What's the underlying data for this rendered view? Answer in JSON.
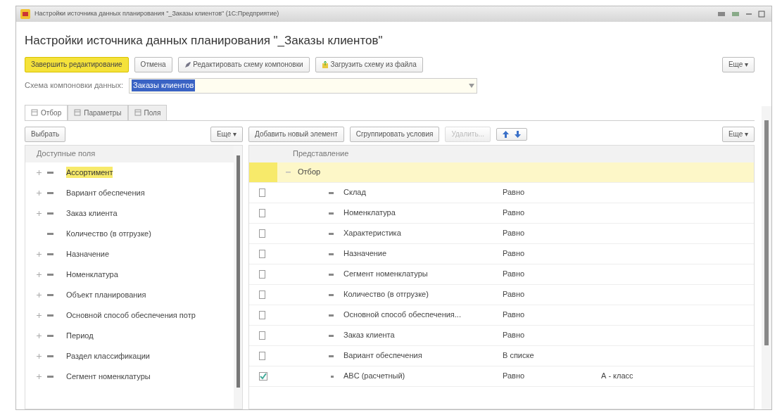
{
  "window": {
    "title": "Настройки источника данных планирования \"_Заказы клиентов\" (1С:Предприятие)"
  },
  "heading": "Настройки источника данных планирования \"_Заказы клиентов\"",
  "toolbar": [
    {
      "label": "Завершить редактирование",
      "kind": "primary"
    },
    {
      "label": "Отмена",
      "kind": "plain"
    },
    {
      "label": "Редактировать схему компоновки",
      "kind": "edit"
    },
    {
      "label": "Загрузить схему из файла",
      "kind": "load"
    }
  ],
  "more_label": "Еще ▾",
  "schema_field": {
    "label": "Схема компоновки данных:",
    "value": "Заказы клиентов"
  },
  "tabs": [
    {
      "label": "Отбор",
      "selected": true
    },
    {
      "label": "Параметры",
      "selected": false
    },
    {
      "label": "Поля",
      "selected": false
    }
  ],
  "left_panel": {
    "select_button": "Выбрать",
    "more_label": "Еще ▾",
    "header": "Доступные поля",
    "items": [
      {
        "label": "Ассортимент",
        "expandable": true,
        "selected": true
      },
      {
        "label": "Вариант обеспечения",
        "expandable": true,
        "selected": false
      },
      {
        "label": "Заказ клиента",
        "expandable": true,
        "selected": false
      },
      {
        "label": "Количество (в отгрузке)",
        "expandable": false,
        "selected": false
      },
      {
        "label": "Назначение",
        "expandable": true,
        "selected": false
      },
      {
        "label": "Номенклатура",
        "expandable": true,
        "selected": false
      },
      {
        "label": "Объект планирования",
        "expandable": true,
        "selected": false
      },
      {
        "label": "Основной способ обеспечения потр",
        "expandable": true,
        "selected": false
      },
      {
        "label": "Период",
        "expandable": true,
        "selected": false
      },
      {
        "label": "Раздел классификации",
        "expandable": true,
        "selected": false
      },
      {
        "label": "Сегмент номенклатуры",
        "expandable": true,
        "selected": false
      }
    ]
  },
  "right_panel": {
    "buttons": [
      {
        "label": "Добавить новый элемент",
        "disabled": false
      },
      {
        "label": "Сгруппировать условия",
        "disabled": false
      },
      {
        "label": "Удалить...",
        "disabled": true
      }
    ],
    "more_label": "Еще ▾",
    "header": "Представление",
    "group": "Отбор",
    "rows": [
      {
        "field": "Склад",
        "comparison": "Равно",
        "checked": false
      },
      {
        "field": "Номенклатура",
        "comparison": "Равно",
        "checked": false
      },
      {
        "field": "Характеристика",
        "comparison": "Равно",
        "checked": false
      },
      {
        "field": "Назначение",
        "comparison": "Равно",
        "checked": false
      },
      {
        "field": "Сегмент номенклатуры",
        "comparison": "Равно",
        "checked": false
      },
      {
        "field": "Количество (в отгрузке)",
        "comparison": "Равно",
        "checked": false
      },
      {
        "field": "Основной способ обеспечения...",
        "comparison": "Равно",
        "checked": false
      },
      {
        "field": "Заказ клиента",
        "comparison": "Равно",
        "checked": false
      },
      {
        "field": "Вариант обеспечения",
        "comparison": "В списке",
        "checked": false
      },
      {
        "field": "ABC (расчетный)",
        "comparison": "Равно",
        "value": "А - класс",
        "checked": true
      }
    ]
  }
}
